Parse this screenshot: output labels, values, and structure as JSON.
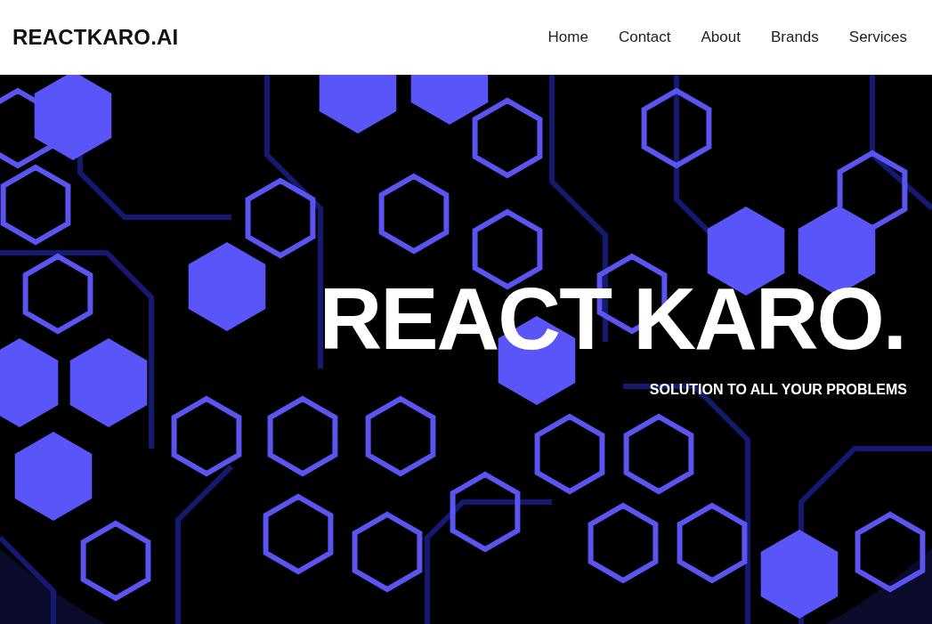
{
  "header": {
    "logo": "REACTKARO.AI",
    "nav": [
      {
        "label": "Home"
      },
      {
        "label": "Contact"
      },
      {
        "label": "About"
      },
      {
        "label": "Brands"
      },
      {
        "label": "Services"
      }
    ]
  },
  "hero": {
    "title": "REACT KARO.",
    "subtitle": "SOLUTION TO ALL YOUR PROBLEMS"
  }
}
